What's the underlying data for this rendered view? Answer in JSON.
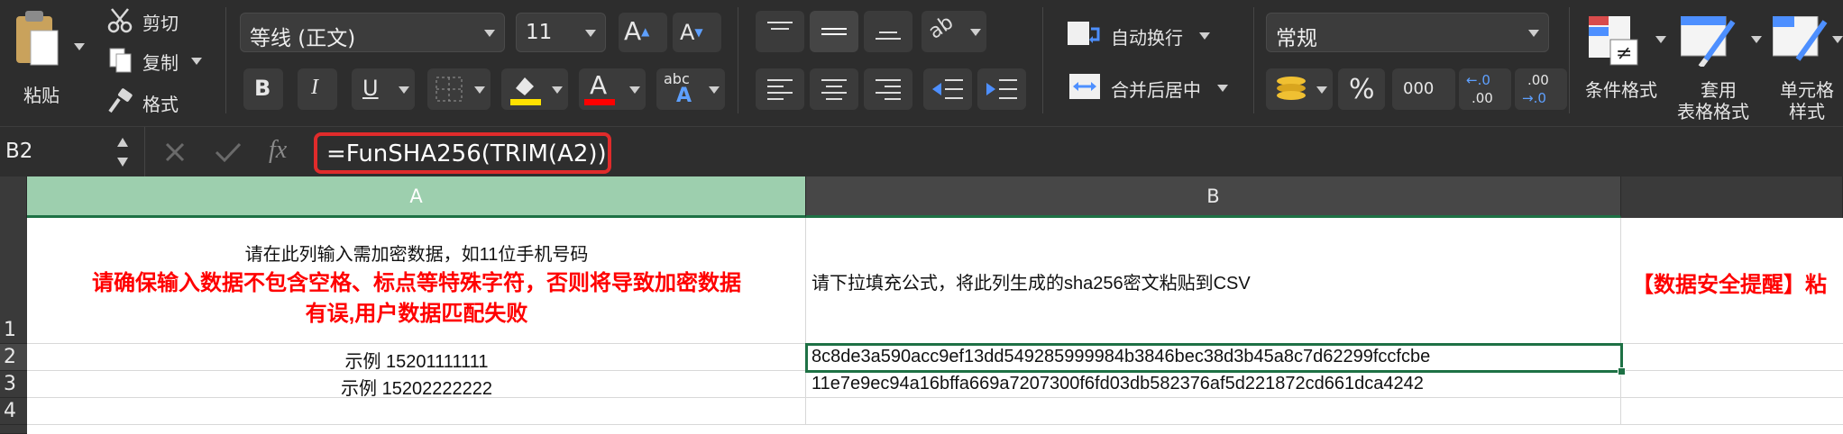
{
  "clipboard": {
    "paste_label": "粘贴",
    "cut_label": "剪切",
    "copy_label": "复制",
    "format_label": "格式"
  },
  "font": {
    "name": "等线 (正文)",
    "size": "11",
    "bold": "B",
    "italic": "I",
    "underline": "U",
    "font_color_glyph": "A",
    "abc_label": "abc",
    "abc_glyph": "A"
  },
  "alignment": {
    "wrap_text_label": "自动换行",
    "merge_center_label": "合并后居中"
  },
  "number": {
    "format_value": "常规",
    "percent_label": "%",
    "thousands_label": "000",
    "inc_decimal_top": "←.0",
    "inc_decimal_bottom": ".00",
    "dec_decimal_top": ".00",
    "dec_decimal_bottom": "→.0"
  },
  "styles": {
    "conditional_format_label": "条件格式",
    "table_format_label_1": "套用",
    "table_format_label_2": "表格格式",
    "cell_style_label_1": "单元格",
    "cell_style_label_2": "样式"
  },
  "formula_bar": {
    "name_box": "B2",
    "fx_label": "fx",
    "formula": "=FunSHA256(TRIM(A2))"
  },
  "colors": {
    "accent_red": "#e02b2b",
    "selected_header": "#9dcfae",
    "selection_border": "#1e7145",
    "warning_text": "#ff0000"
  },
  "sheet": {
    "columns": [
      "A",
      "B"
    ],
    "rows": [
      "1",
      "2",
      "3",
      "4"
    ],
    "a1_line1": "请在此列输入需加密数据，如11位手机号码",
    "a1_line2": "请确保输入数据不包含空格、标点等特殊字符，否则将导致加密数据",
    "a1_line3": "有误,用户数据匹配失败",
    "b1": "请下拉填充公式，将此列生成的sha256密文粘贴到CSV",
    "c1": "【数据安全提醒】粘",
    "a2": "示例 15201111111",
    "b2": "8c8de3a590acc9ef13dd549285999984b3846bec38d3b45a8c7d62299fccfcbe",
    "a3": "示例 15202222222",
    "b3": "11e7e9ec94a16bffa669a7207300f6fd03db582376af5d221872cd661dca4242"
  }
}
